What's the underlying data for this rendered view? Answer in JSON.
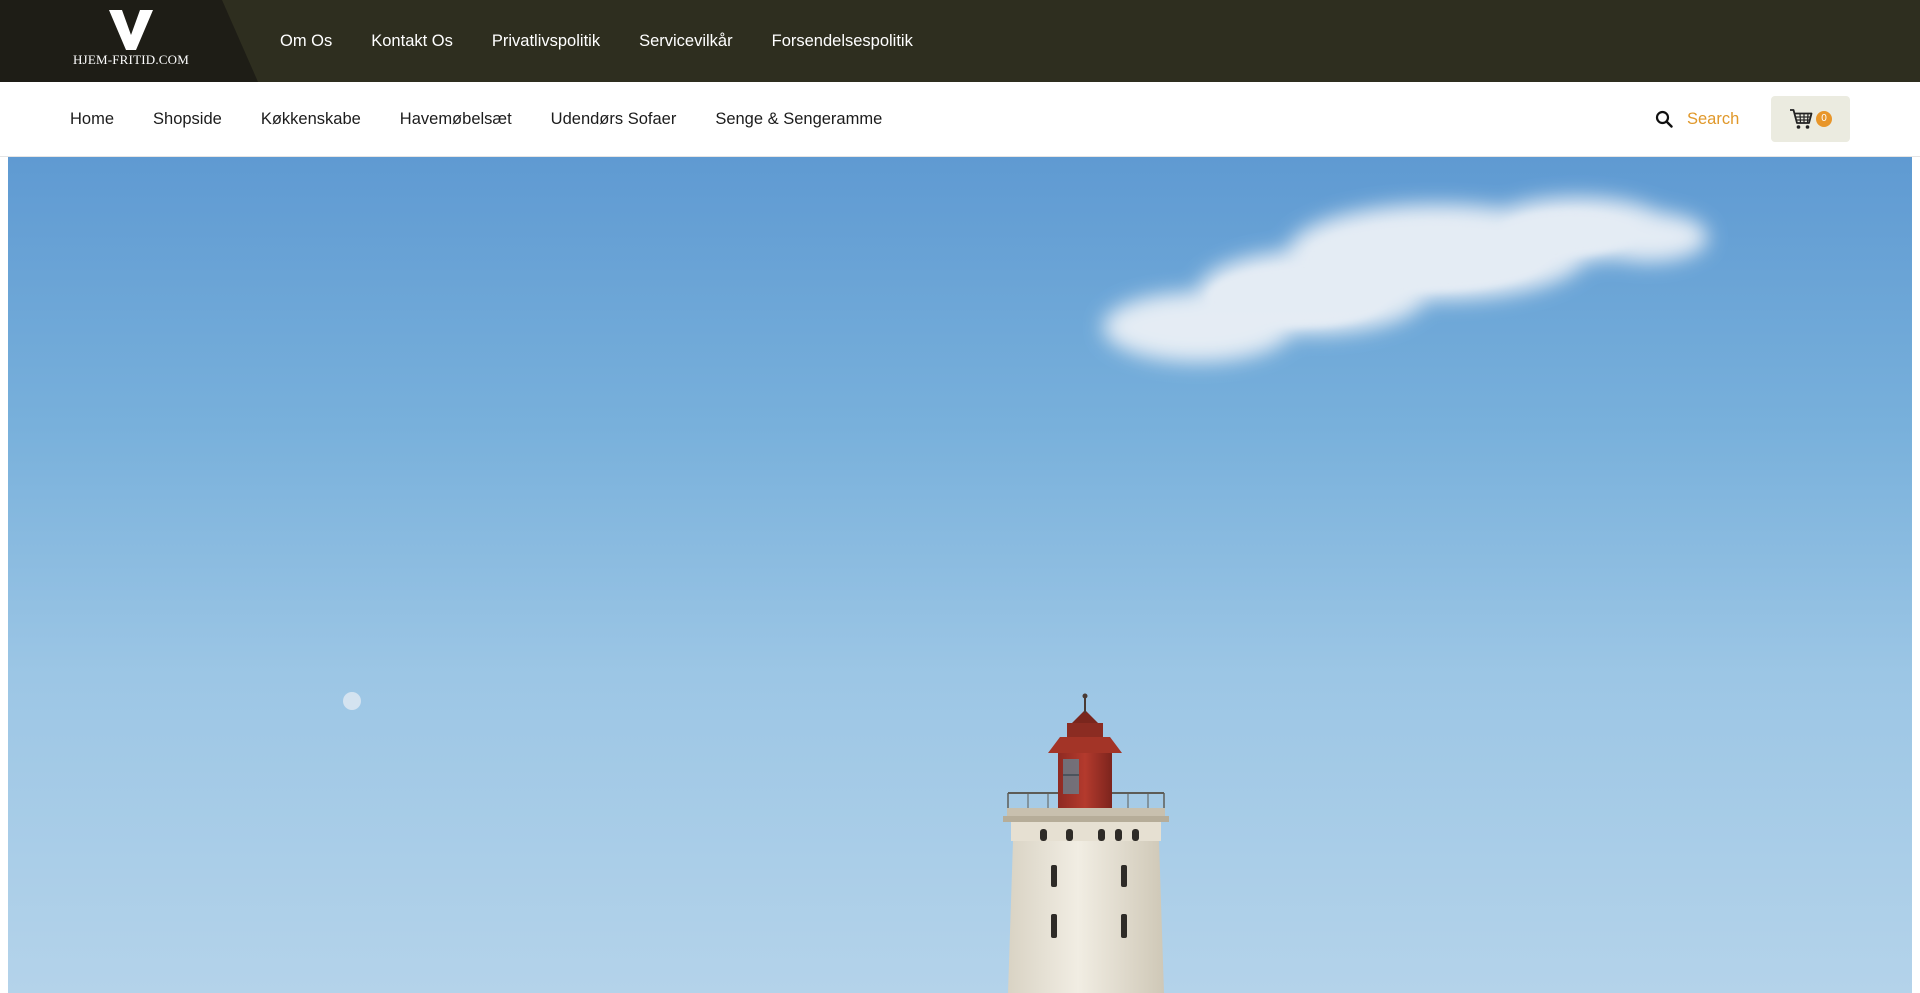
{
  "brand": {
    "name": "HJEM-FRITID.COM",
    "logo_mark": "V"
  },
  "top_nav": {
    "items": [
      {
        "label": "Om Os"
      },
      {
        "label": "Kontakt Os"
      },
      {
        "label": "Privatlivspolitik"
      },
      {
        "label": "Servicevilkår"
      },
      {
        "label": "Forsendelsespolitik"
      }
    ]
  },
  "main_nav": {
    "items": [
      {
        "label": "Home"
      },
      {
        "label": "Shopside"
      },
      {
        "label": "Køkkenskabe"
      },
      {
        "label": "Havemøbelsæt"
      },
      {
        "label": "Udendørs Sofaer"
      },
      {
        "label": "Senge & Sengeramme"
      }
    ]
  },
  "search": {
    "label": "Search",
    "icon": "search-icon"
  },
  "cart": {
    "icon": "cart-icon",
    "count": "0"
  },
  "hero": {
    "image": "lighthouse-photo"
  },
  "colors": {
    "topbar": "#2e2e1f",
    "logo_bg": "#1e1d16",
    "accent": "#e0982a",
    "cart_bg": "#ebebe0"
  }
}
